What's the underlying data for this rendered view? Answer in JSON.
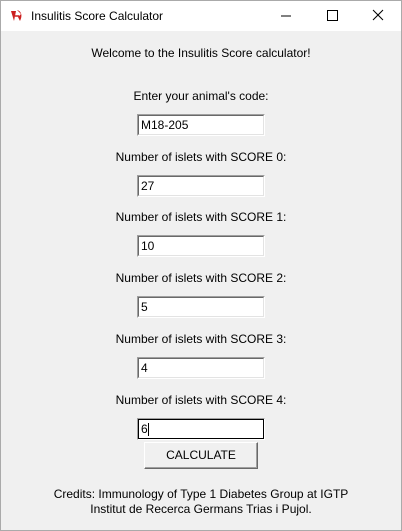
{
  "window": {
    "title": "Insulitis Score Calculator",
    "icon": "tk-feather-icon",
    "controls": [
      "minimize-icon",
      "maximize-icon",
      "close-icon"
    ]
  },
  "welcome": "Welcome to the Insulitis Score calculator!",
  "form": {
    "code_label": "Enter your animal's code:",
    "code_value": "M18-205",
    "score0_label": "Number of islets with SCORE 0:",
    "score0_value": "27",
    "score1_label": "Number of islets with SCORE 1:",
    "score1_value": "10",
    "score2_label": "Number of islets with SCORE 2:",
    "score2_value": "5",
    "score3_label": "Number of islets with SCORE 3:",
    "score3_value": "4",
    "score4_label": "Number of islets with SCORE 4:",
    "score4_value": "6"
  },
  "calculate_label": "CALCULATE",
  "credits": {
    "line1": "Credits: Immunology of Type 1 Diabetes Group at IGTP",
    "line2": "Institut de Recerca Germans Trias i Pujol."
  },
  "colors": {
    "window_bg": "#f0f0f0",
    "titlebar_bg": "#ffffff",
    "icon_red": "#cc1f1f"
  }
}
